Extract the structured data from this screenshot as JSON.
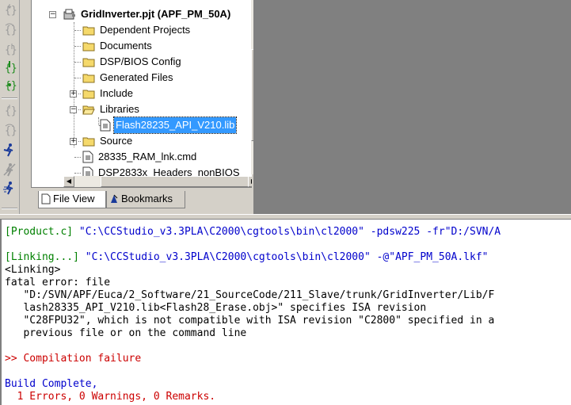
{
  "tree": {
    "project": "GridInverter.pjt (APF_PM_50A)",
    "items": [
      {
        "label": "Dependent Projects"
      },
      {
        "label": "Documents"
      },
      {
        "label": "DSP/BIOS Config"
      },
      {
        "label": "Generated Files"
      },
      {
        "label": "Include",
        "expander": "+"
      },
      {
        "label": "Libraries",
        "expander": "−"
      },
      {
        "label": "Source",
        "expander": "+"
      }
    ],
    "library_file": "Flash28235_API_V210.lib",
    "files": [
      "28335_RAM_lnk.cmd",
      "DSP2833x_Headers_nonBIOS"
    ]
  },
  "tabs": {
    "file_view": "File View",
    "bookmarks": "Bookmarks"
  },
  "output": {
    "line1_tag": "[Product.c]",
    "line1_text": " \"C:\\CCStudio_v3.3PLA\\C2000\\cgtools\\bin\\cl2000\" -pdsw225 -fr\"D:/SVN/A",
    "line2_tag": "[Linking...]",
    "line2_text": " \"C:\\CCStudio_v3.3PLA\\C2000\\cgtools\\bin\\cl2000\" -@\"APF_PM_50A.lkf\"",
    "line3": "<Linking>",
    "line4": "fatal error: file",
    "line5": "   \"D:/SVN/APF/Euca/2_Software/21_SourceCode/211_Slave/trunk/GridInverter/Lib/F",
    "line6": "   lash28335_API_V210.lib<Flash28_Erase.obj>\" specifies ISA revision",
    "line7": "   \"C28FPU32\", which is not compatible with ISA revision \"C2800\" specified in a",
    "line8": "   previous file or on the command line",
    "line9": ">> Compilation failure",
    "line10": "Build Complete,",
    "line11": "  1 Errors, 0 Warnings, 0 Remarks."
  },
  "colors": {
    "command": "#008000",
    "path": "#0000cc",
    "error": "#cc0000",
    "selection": "#3399ff"
  }
}
